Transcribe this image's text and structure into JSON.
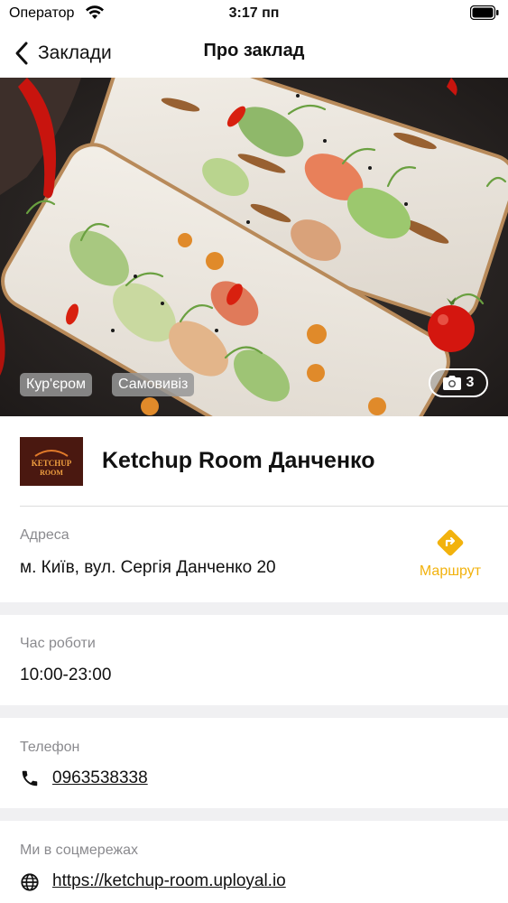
{
  "status_bar": {
    "carrier": "Оператор",
    "time": "3:17 пп"
  },
  "nav": {
    "back_label": "Заклади",
    "title": "Про заклад"
  },
  "hero": {
    "tags": [
      "Кур'єром",
      "Самовивіз"
    ],
    "photo_count": "3"
  },
  "venue": {
    "name": "Ketchup Room Данченко",
    "logo_line1": "KETCHUP",
    "logo_line2": "ROOM"
  },
  "address": {
    "label": "Адреса",
    "value": "м. Київ, вул. Сергія Данченко 20",
    "route_label": "Маршрут"
  },
  "hours": {
    "label": "Час роботи",
    "value": "10:00-23:00"
  },
  "phone": {
    "label": "Телефон",
    "value": "0963538338"
  },
  "social": {
    "label": "Ми в соцмережах",
    "value": "https://ketchup-room.uployal.io"
  },
  "colors": {
    "accent": "#f2b20d",
    "section_gap": "#f0f0f2",
    "secondary_text": "#8a8a8e"
  }
}
